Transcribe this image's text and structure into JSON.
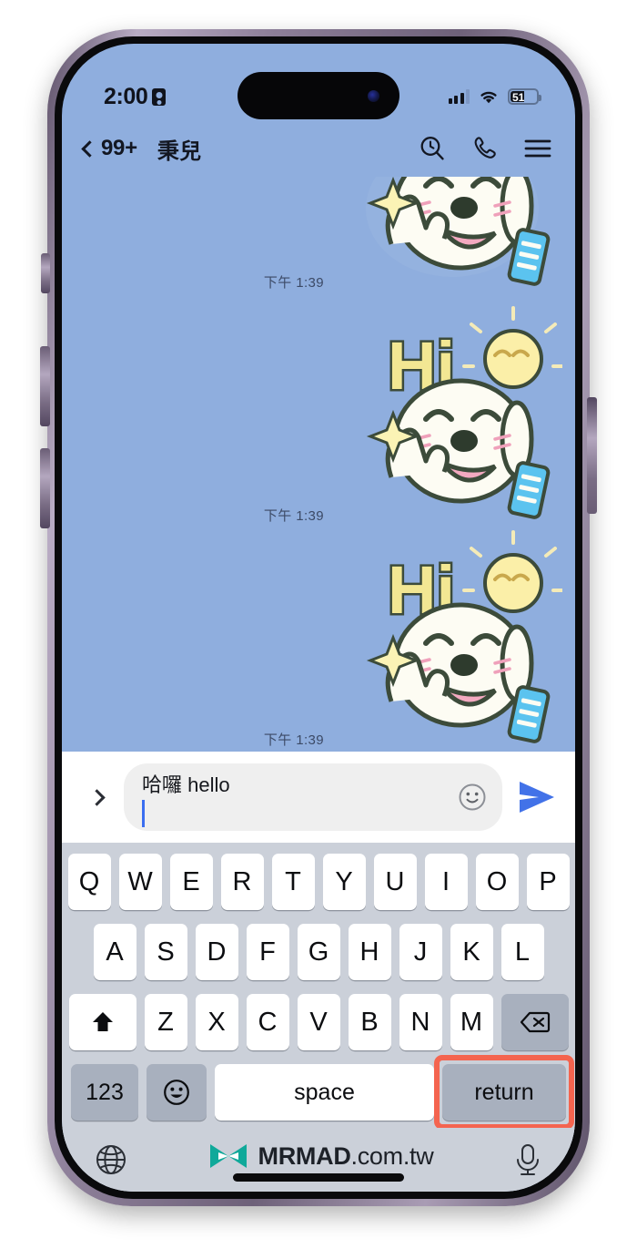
{
  "status_bar": {
    "time": "2:00",
    "lock_icon": "lock-portrait-icon",
    "signal_icon": "cellular-signal-icon",
    "wifi_icon": "wifi-icon",
    "battery_percent": "51",
    "battery_level": 51
  },
  "nav": {
    "back_icon": "chevron-left-icon",
    "unread_count": "99+",
    "contact_name": "秉兒",
    "search_icon": "search-history-icon",
    "call_icon": "phone-call-icon",
    "menu_icon": "hamburger-menu-icon"
  },
  "chat": {
    "background_color": "#8FAEDE",
    "messages": [
      {
        "type": "sticker",
        "sticker_name": "hi-dog-sticker",
        "time": "下午 1:39",
        "side": "right"
      },
      {
        "type": "sticker",
        "sticker_name": "hi-dog-sticker",
        "time": "下午 1:39",
        "side": "right"
      },
      {
        "type": "sticker",
        "sticker_name": "hi-dog-sticker",
        "time": "下午 1:39",
        "side": "right"
      }
    ]
  },
  "input_bar": {
    "more_icon": "chevron-right-icon",
    "text_value": "哈囉 hello",
    "placeholder": "",
    "emoji_icon": "emoji-smiley-icon",
    "send_icon": "send-paper-plane-icon",
    "send_color": "#4272E8"
  },
  "keyboard": {
    "row1": [
      "Q",
      "W",
      "E",
      "R",
      "T",
      "Y",
      "U",
      "I",
      "O",
      "P"
    ],
    "row2": [
      "A",
      "S",
      "D",
      "F",
      "G",
      "H",
      "J",
      "K",
      "L"
    ],
    "row3": [
      "Z",
      "X",
      "C",
      "V",
      "B",
      "N",
      "M"
    ],
    "shift_icon": "shift-arrow-icon",
    "backspace_icon": "backspace-delete-icon",
    "number_key": "123",
    "emoji_key_icon": "emoji-face-icon",
    "space_key": "space",
    "return_key": "return",
    "highlight_color": "#F4644F",
    "highlighted_key": "return"
  },
  "bottom_bar": {
    "globe_icon": "globe-language-icon",
    "mic_icon": "microphone-icon",
    "watermark_logo": "mrmad-infinity-logo",
    "watermark_bold": "MRMAD",
    "watermark_rest": ".com.tw",
    "watermark_color": "#0FA99A"
  }
}
